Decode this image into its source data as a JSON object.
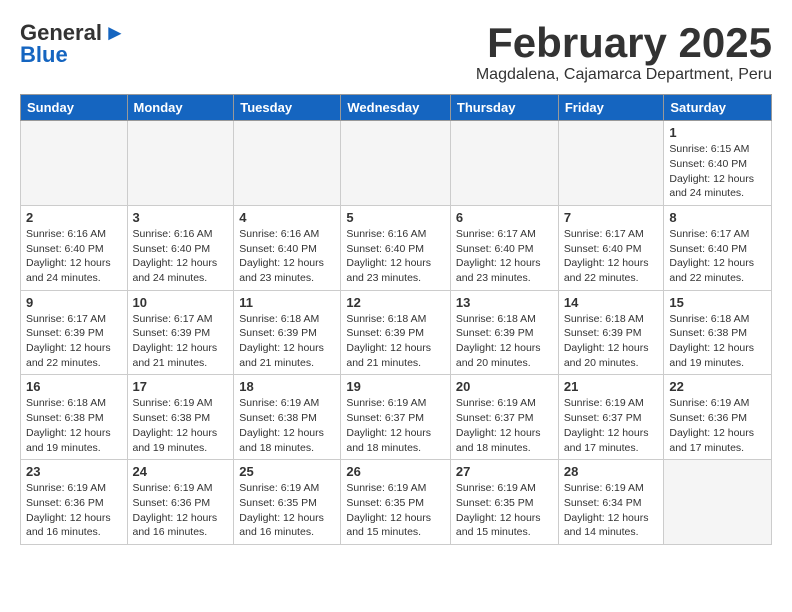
{
  "header": {
    "logo_general": "General",
    "logo_blue": "Blue",
    "title": "February 2025",
    "subtitle": "Magdalena, Cajamarca Department, Peru"
  },
  "days_of_week": [
    "Sunday",
    "Monday",
    "Tuesday",
    "Wednesday",
    "Thursday",
    "Friday",
    "Saturday"
  ],
  "weeks": [
    [
      {
        "day": "",
        "info": ""
      },
      {
        "day": "",
        "info": ""
      },
      {
        "day": "",
        "info": ""
      },
      {
        "day": "",
        "info": ""
      },
      {
        "day": "",
        "info": ""
      },
      {
        "day": "",
        "info": ""
      },
      {
        "day": "1",
        "info": "Sunrise: 6:15 AM\nSunset: 6:40 PM\nDaylight: 12 hours and 24 minutes."
      }
    ],
    [
      {
        "day": "2",
        "info": "Sunrise: 6:16 AM\nSunset: 6:40 PM\nDaylight: 12 hours and 24 minutes."
      },
      {
        "day": "3",
        "info": "Sunrise: 6:16 AM\nSunset: 6:40 PM\nDaylight: 12 hours and 24 minutes."
      },
      {
        "day": "4",
        "info": "Sunrise: 6:16 AM\nSunset: 6:40 PM\nDaylight: 12 hours and 23 minutes."
      },
      {
        "day": "5",
        "info": "Sunrise: 6:16 AM\nSunset: 6:40 PM\nDaylight: 12 hours and 23 minutes."
      },
      {
        "day": "6",
        "info": "Sunrise: 6:17 AM\nSunset: 6:40 PM\nDaylight: 12 hours and 23 minutes."
      },
      {
        "day": "7",
        "info": "Sunrise: 6:17 AM\nSunset: 6:40 PM\nDaylight: 12 hours and 22 minutes."
      },
      {
        "day": "8",
        "info": "Sunrise: 6:17 AM\nSunset: 6:40 PM\nDaylight: 12 hours and 22 minutes."
      }
    ],
    [
      {
        "day": "9",
        "info": "Sunrise: 6:17 AM\nSunset: 6:39 PM\nDaylight: 12 hours and 22 minutes."
      },
      {
        "day": "10",
        "info": "Sunrise: 6:17 AM\nSunset: 6:39 PM\nDaylight: 12 hours and 21 minutes."
      },
      {
        "day": "11",
        "info": "Sunrise: 6:18 AM\nSunset: 6:39 PM\nDaylight: 12 hours and 21 minutes."
      },
      {
        "day": "12",
        "info": "Sunrise: 6:18 AM\nSunset: 6:39 PM\nDaylight: 12 hours and 21 minutes."
      },
      {
        "day": "13",
        "info": "Sunrise: 6:18 AM\nSunset: 6:39 PM\nDaylight: 12 hours and 20 minutes."
      },
      {
        "day": "14",
        "info": "Sunrise: 6:18 AM\nSunset: 6:39 PM\nDaylight: 12 hours and 20 minutes."
      },
      {
        "day": "15",
        "info": "Sunrise: 6:18 AM\nSunset: 6:38 PM\nDaylight: 12 hours and 19 minutes."
      }
    ],
    [
      {
        "day": "16",
        "info": "Sunrise: 6:18 AM\nSunset: 6:38 PM\nDaylight: 12 hours and 19 minutes."
      },
      {
        "day": "17",
        "info": "Sunrise: 6:19 AM\nSunset: 6:38 PM\nDaylight: 12 hours and 19 minutes."
      },
      {
        "day": "18",
        "info": "Sunrise: 6:19 AM\nSunset: 6:38 PM\nDaylight: 12 hours and 18 minutes."
      },
      {
        "day": "19",
        "info": "Sunrise: 6:19 AM\nSunset: 6:37 PM\nDaylight: 12 hours and 18 minutes."
      },
      {
        "day": "20",
        "info": "Sunrise: 6:19 AM\nSunset: 6:37 PM\nDaylight: 12 hours and 18 minutes."
      },
      {
        "day": "21",
        "info": "Sunrise: 6:19 AM\nSunset: 6:37 PM\nDaylight: 12 hours and 17 minutes."
      },
      {
        "day": "22",
        "info": "Sunrise: 6:19 AM\nSunset: 6:36 PM\nDaylight: 12 hours and 17 minutes."
      }
    ],
    [
      {
        "day": "23",
        "info": "Sunrise: 6:19 AM\nSunset: 6:36 PM\nDaylight: 12 hours and 16 minutes."
      },
      {
        "day": "24",
        "info": "Sunrise: 6:19 AM\nSunset: 6:36 PM\nDaylight: 12 hours and 16 minutes."
      },
      {
        "day": "25",
        "info": "Sunrise: 6:19 AM\nSunset: 6:35 PM\nDaylight: 12 hours and 16 minutes."
      },
      {
        "day": "26",
        "info": "Sunrise: 6:19 AM\nSunset: 6:35 PM\nDaylight: 12 hours and 15 minutes."
      },
      {
        "day": "27",
        "info": "Sunrise: 6:19 AM\nSunset: 6:35 PM\nDaylight: 12 hours and 15 minutes."
      },
      {
        "day": "28",
        "info": "Sunrise: 6:19 AM\nSunset: 6:34 PM\nDaylight: 12 hours and 14 minutes."
      },
      {
        "day": "",
        "info": ""
      }
    ]
  ]
}
